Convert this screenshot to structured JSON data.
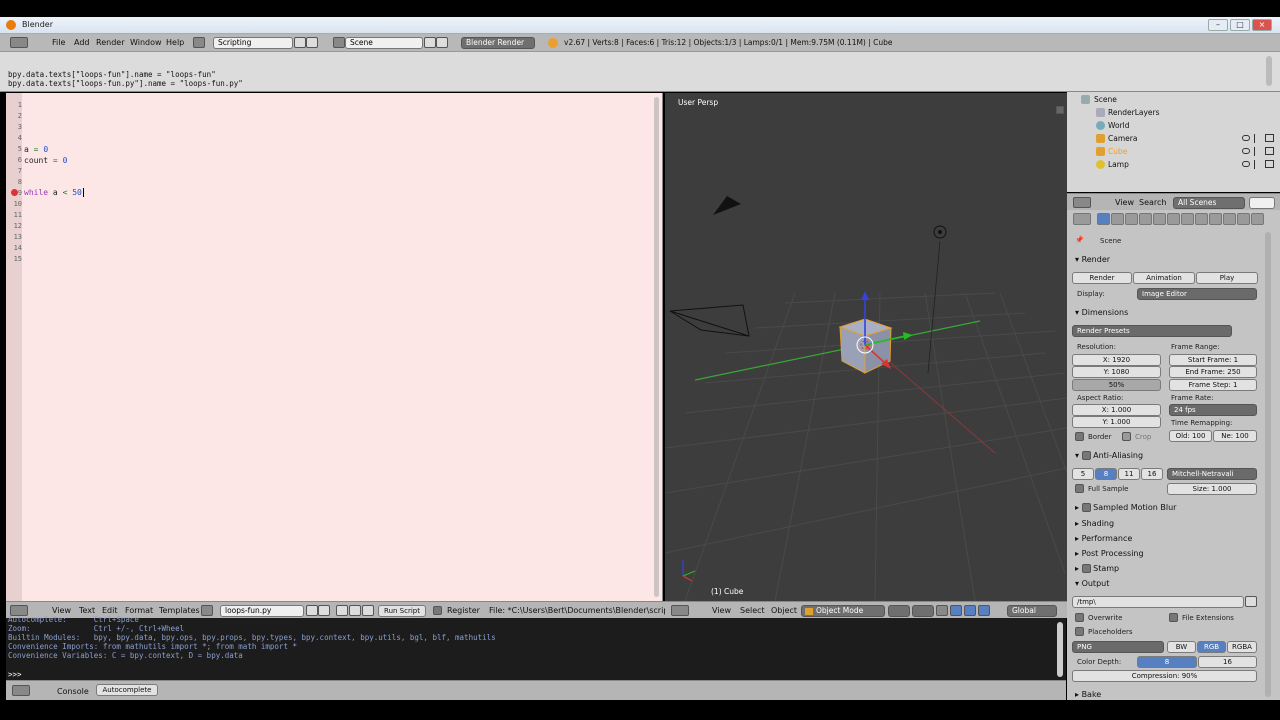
{
  "window": {
    "title": "Blender"
  },
  "info_header": {
    "menus": [
      "File",
      "Add",
      "Render",
      "Window",
      "Help"
    ],
    "layout": "Scripting",
    "scene": "Scene",
    "engine": "Blender Render",
    "stats": "v2.67 | Verts:8 | Faces:6 | Tris:12 | Objects:1/3 | Lamps:0/1 | Mem:9.75M (0.11M) | Cube"
  },
  "info_log": [
    "bpy.data.texts[\"loops-fun\"].name = \"loops-fun\"",
    "bpy.data.texts[\"loops-fun.py\"].name = \"loops-fun.py\""
  ],
  "text_editor": {
    "line_numbers": [
      "1",
      "2",
      "3",
      "4",
      "5",
      "6",
      "7",
      "8",
      "9",
      "10",
      "11",
      "12",
      "13",
      "14",
      "15"
    ],
    "code": {
      "l6_var": "a",
      "l6_op": "=",
      "l6_val": "0",
      "l7_var": "count",
      "l7_op": "=",
      "l7_val": "0",
      "l10_kw": "while",
      "l10_var": "a",
      "l10_op": "<",
      "l10_val": "50"
    },
    "header": {
      "menus": [
        "View",
        "Text",
        "Edit",
        "Format",
        "Templates"
      ],
      "filename": "loops-fun.py",
      "run_script": "Run Script",
      "register": "Register",
      "file_path": "File: *C:\\Users\\Bert\\Documents\\Blender\\scripting\\"
    }
  },
  "viewport": {
    "label": "User Persp",
    "object_label": "(1) Cube",
    "header": {
      "menus": [
        "View",
        "Select",
        "Object"
      ],
      "mode": "Object Mode",
      "orientation": "Global"
    }
  },
  "console": {
    "lines": [
      "Autocomplete:      Ctrl+Space",
      "Zoom:              Ctrl +/-, Ctrl+Wheel",
      "Builtin Modules:   bpy, bpy.data, bpy.ops, bpy.props, bpy.types, bpy.context, bpy.utils, bgl, blf, mathutils",
      "Convenience Imports: from mathutils import *; from math import *",
      "Convenience Variables: C = bpy.context, D = bpy.data"
    ],
    "prompt": ">>> ",
    "tabs": [
      "Console",
      "Autocomplete"
    ]
  },
  "outliner": {
    "items": [
      "Scene",
      "RenderLayers",
      "World",
      "Camera",
      "Cube",
      "Lamp"
    ],
    "header": {
      "view": "View",
      "search": "Search",
      "filter": "All Scenes"
    }
  },
  "properties": {
    "scene_label": "Scene",
    "render_section": "Render",
    "render_btn": "Render",
    "animation_btn": "Animation",
    "play_btn": "Play",
    "display_label": "Display:",
    "display_value": "Image Editor",
    "dimensions_section": "Dimensions",
    "render_presets": "Render Presets",
    "resolution_label": "Resolution:",
    "res_x": "X: 1920",
    "res_y": "Y: 1080",
    "res_pct": "50%",
    "frame_range_label": "Frame Range:",
    "start_frame": "Start Frame: 1",
    "end_frame": "End Frame: 250",
    "frame_step": "Frame Step: 1",
    "aspect_label": "Aspect Ratio:",
    "aspect_x": "X: 1.000",
    "aspect_y": "Y: 1.000",
    "frame_rate_label": "Frame Rate:",
    "frame_rate": "24 fps",
    "time_remap_label": "Time Remapping:",
    "old": "Old: 100",
    "new": "Ne: 100",
    "border": "Border",
    "crop": "Crop",
    "aa_section": "Anti-Aliasing",
    "aa_samples": [
      "5",
      "8",
      "11",
      "16"
    ],
    "aa_filter": "Mitchell-Netravali",
    "full_sample": "Full Sample",
    "aa_size": "Size: 1.000",
    "motion_blur": "Sampled Motion Blur",
    "shading": "Shading",
    "performance": "Performance",
    "post_processing": "Post Processing",
    "stamp": "Stamp",
    "output_section": "Output",
    "output_path": "/tmp\\",
    "overwrite": "Overwrite",
    "file_extensions": "File Extensions",
    "placeholders": "Placeholders",
    "format": "PNG",
    "bw": "BW",
    "rgb": "RGB",
    "rgba": "RGBA",
    "color_depth_label": "Color Depth:",
    "depth8": "8",
    "depth16": "16",
    "compression": "Compression: 90%",
    "bake": "Bake"
  },
  "colors": {
    "text_bg": "#fde6e6",
    "viewport_bg": "#3d3d3d",
    "console_bg": "#1c1c1c",
    "selection_blue": "#5680c2"
  }
}
